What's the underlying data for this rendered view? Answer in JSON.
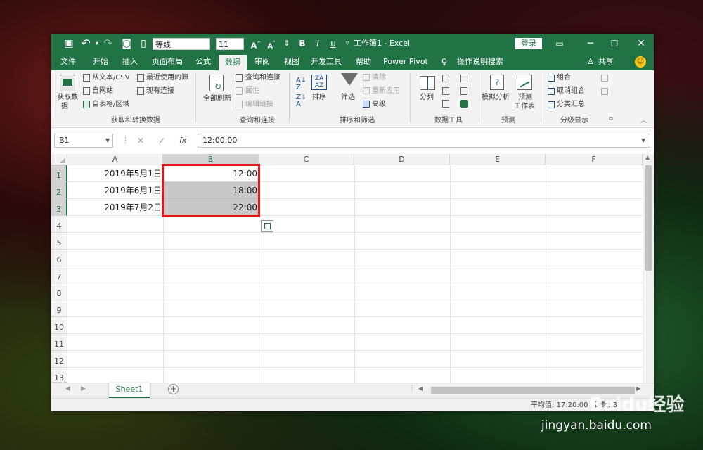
{
  "quick_access": {
    "font_name": "等线",
    "font_size": "11"
  },
  "titlebar": {
    "title": "工作簿1 - Excel",
    "login_label": "登录"
  },
  "tabs": [
    "文件",
    "开始",
    "插入",
    "页面布局",
    "公式",
    "数据",
    "审阅",
    "视图",
    "开发工具",
    "帮助",
    "Power Pivot"
  ],
  "tell_me": "操作说明搜索",
  "share": "共享",
  "ribbon": {
    "get_transform": {
      "big": "获取数",
      "big2": "据",
      "from_text": "从文本/CSV",
      "from_web": "自网站",
      "from_table": "自表格/区域",
      "recent": "最近使用的源",
      "existing": "现有连接",
      "label": "获取和转换数据"
    },
    "queries": {
      "refresh_all": "全部刷新",
      "queries_conn": "查询和连接",
      "properties": "属性",
      "edit_links": "编辑链接",
      "label": "查询和连接"
    },
    "sort_filter": {
      "sort": "排序",
      "filter": "筛选",
      "clear": "清除",
      "reapply": "重新应用",
      "advanced": "高级",
      "label": "排序和筛选"
    },
    "data_tools": {
      "text_to_columns": "分列",
      "label": "数据工具"
    },
    "forecast": {
      "what_if": "模拟分析",
      "forecast_sheet": "预测",
      "forecast_sheet2": "工作表",
      "label": "预测"
    },
    "outline": {
      "group": "组合",
      "ungroup": "取消组合",
      "subtotal": "分类汇总",
      "label": "分级显示"
    }
  },
  "formula_bar": {
    "name_box": "B1",
    "formula": "12:00:00"
  },
  "columns": [
    "A",
    "B",
    "C",
    "D",
    "E",
    "F"
  ],
  "rows": [
    "1",
    "2",
    "3",
    "4",
    "5",
    "6",
    "7",
    "8",
    "9",
    "10",
    "11",
    "12",
    "13"
  ],
  "cells": {
    "A1": "2019年5月1日",
    "A2": "2019年6月1日",
    "A3": "2019年7月2日",
    "B1": "12:00",
    "B2": "18:00",
    "B3": "22:00"
  },
  "sheet_tab": "Sheet1",
  "status": {
    "left": "平均值: 17:20:00",
    "right": "计数: 3"
  },
  "colors": {
    "excel_green": "#217346",
    "highlight_red": "#e8121b",
    "selection_gray": "#c8c8c8"
  },
  "watermark": {
    "brand": "Baidu经验",
    "url": "jingyan.baidu.com"
  }
}
